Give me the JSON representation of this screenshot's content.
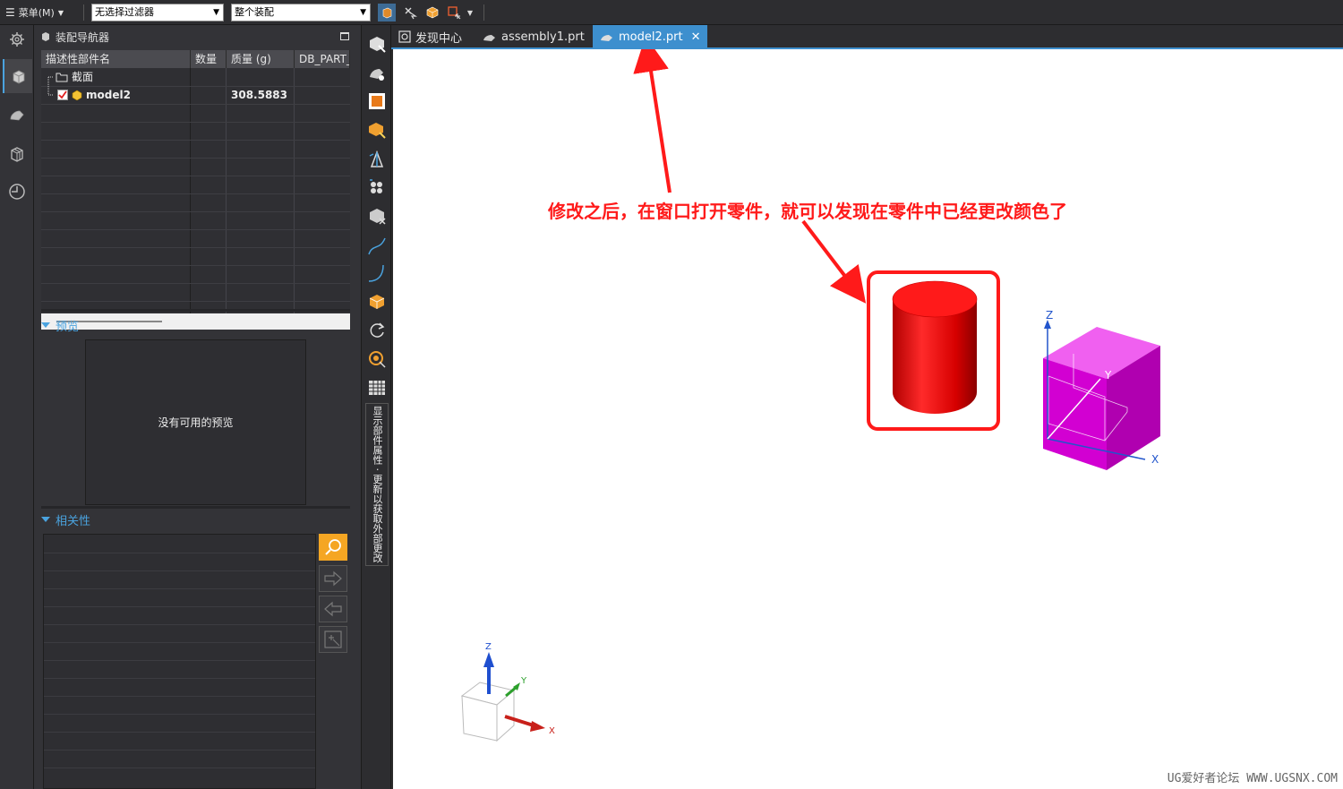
{
  "toolbar": {
    "menu_label": "菜单(M)",
    "filter_value": "无选择过滤器",
    "scope_value": "整个装配"
  },
  "navigator": {
    "title": "装配导航器",
    "columns": [
      "描述性部件名",
      "数量",
      "质量 (g)",
      "DB_PART_"
    ],
    "rows": [
      {
        "name": "截面",
        "qty": "",
        "mass": ""
      },
      {
        "name": "model2",
        "qty": "",
        "mass": "308.5883"
      }
    ]
  },
  "preview": {
    "header": "预览",
    "empty_text": "没有可用的预览"
  },
  "dependency": {
    "header": "相关性"
  },
  "vertical_toolbar": {
    "label": "显示部件属性 · 更新以获取外部更改"
  },
  "tabs": [
    {
      "label": "发现中心",
      "icon": "discovery-icon"
    },
    {
      "label": "assembly1.prt",
      "icon": "assembly-icon"
    },
    {
      "label": "model2.prt",
      "icon": "part-icon",
      "active": true,
      "close": "✕"
    }
  ],
  "viewport": {
    "annotation": "修改之后，在窗口打开零件，就可以发现在零件中已经更改颜色了",
    "csys_labels": {
      "z": "Z",
      "y": "Y",
      "x": "X"
    },
    "watermark": "UG爱好者论坛 WWW.UGSNX.COM",
    "colors": {
      "cylinder": "#e00000",
      "block": "#e000e0",
      "highlight": "#ff1a1a",
      "accent": "#3d8fce"
    }
  }
}
